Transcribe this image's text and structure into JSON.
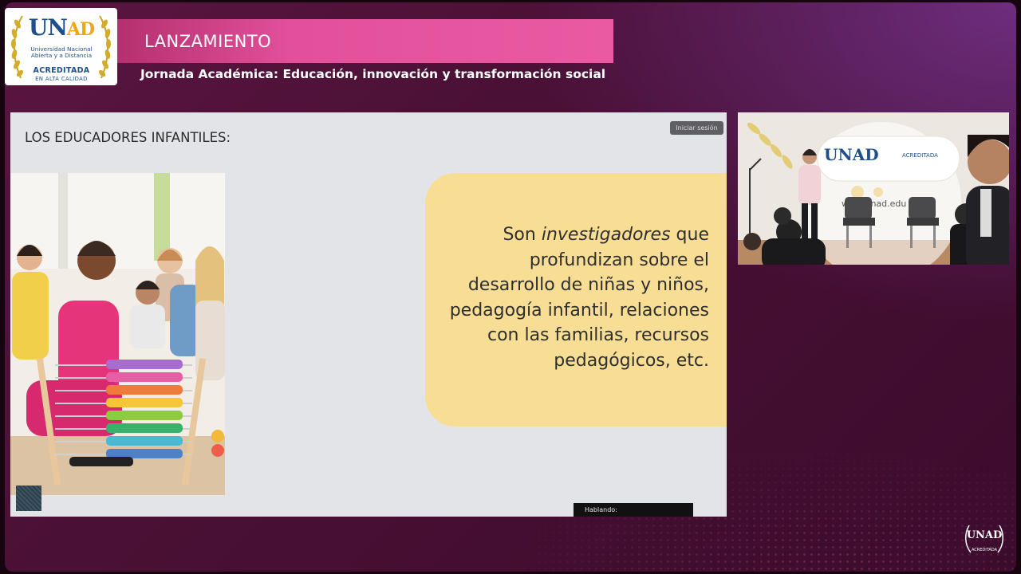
{
  "logo": {
    "word_u": "UN",
    "word_ad": "AD",
    "line1": "Universidad Nacional",
    "line2": "Abierta y a Distancia",
    "accredited": "ACREDITADA",
    "quality": "EN ALTA CALIDAD"
  },
  "header": {
    "title": "LANZAMIENTO",
    "subtitle": "Jornada Académica: Educación, innovación y transformación social"
  },
  "slide": {
    "heading": "LOS EDUCADORES INFANTILES:",
    "signin_label": "Iniciar sesión",
    "bubble": {
      "pre": "Son ",
      "emphasis": "investigadores",
      "post": " que profundizan sobre el desarrollo de niñas y niños, pedagogía infantil, relaciones con las familias, recursos pedagógicos, etc."
    },
    "speaking_label": "Hablando:"
  },
  "camera": {
    "backdrop_logo": "UNAD",
    "backdrop_acr": "ACREDITADA",
    "backdrop_url": "www.unad.edu"
  },
  "corner_logo": {
    "word": "UNAD",
    "acr": "ACREDITADA"
  },
  "colors": {
    "brand_blue": "#1e4f8a",
    "brand_gold": "#f0a61c",
    "banner_pink": "#e2509b",
    "bubble_yellow": "#f8dd95"
  }
}
